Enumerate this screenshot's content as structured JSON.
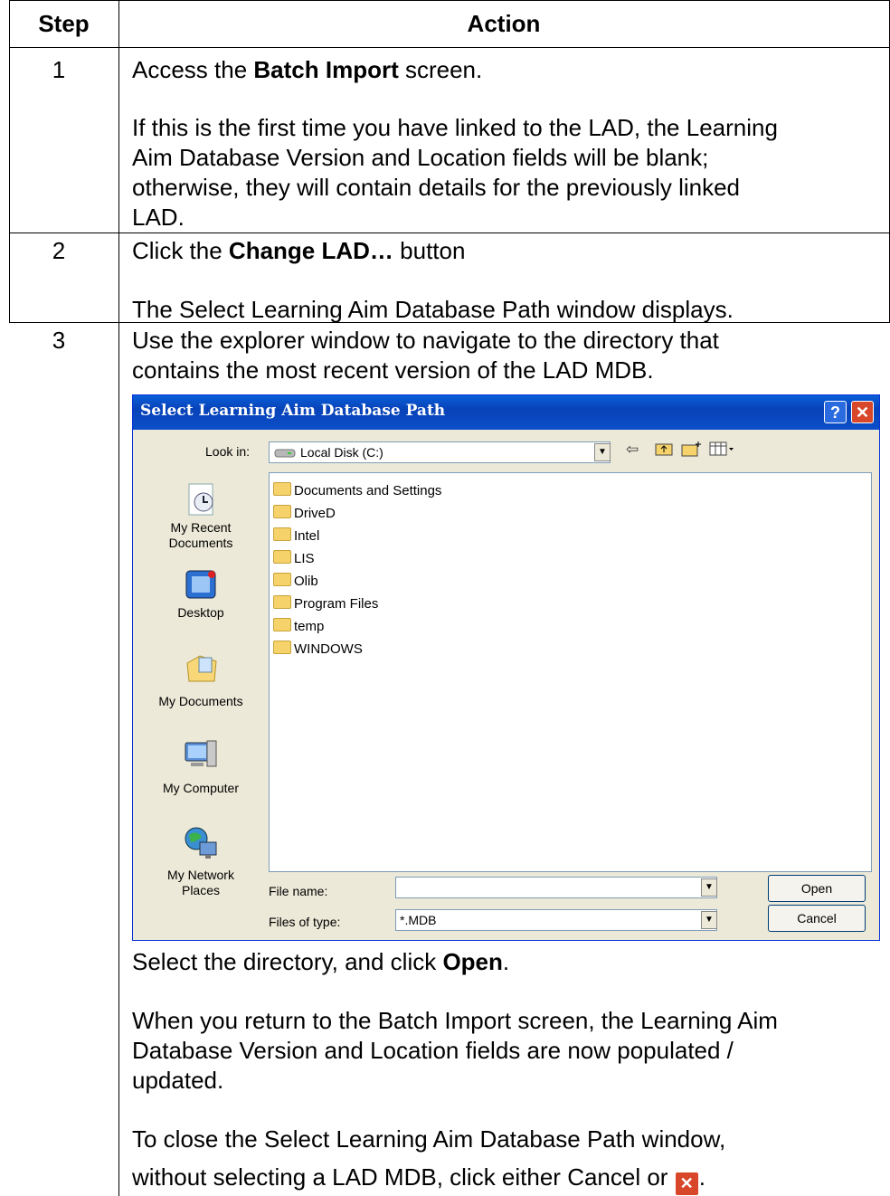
{
  "table": {
    "header_step": "Step",
    "header_action": "Action",
    "rows": [
      {
        "step": "1",
        "lines": [
          {
            "pre": "Access the ",
            "bold": "Batch Import",
            "post": " screen."
          },
          {
            "text": "If this is the first time you have linked to the LAD, the Learning"
          },
          {
            "text": "Aim Database Version and Location fields will be blank;"
          },
          {
            "text": "otherwise, they will contain details for the previously linked"
          },
          {
            "text": "LAD."
          }
        ]
      },
      {
        "step": "2",
        "lines": [
          {
            "pre": "Click the ",
            "bold": "Change LAD…",
            "post": " button"
          },
          {
            "text": "The Select Learning Aim Database Path window displays."
          }
        ]
      },
      {
        "step": "3",
        "lines": [
          {
            "text": "Use the explorer window to navigate to the directory that"
          },
          {
            "text": "contains the most recent version of the LAD MDB."
          },
          {
            "pre": "Select the directory, and click ",
            "bold": "Open",
            "post": "."
          },
          {
            "text": "When you return to the Batch Import screen, the Learning Aim"
          },
          {
            "text": "Database Version and Location fields are now populated /"
          },
          {
            "text": "updated."
          },
          {
            "text": "To close the Select Learning Aim Database Path window,"
          },
          {
            "text": "without selecting a LAD MDB, click either Cancel or",
            "post": "."
          }
        ]
      }
    ]
  },
  "dialog": {
    "title": "Select Learning Aim Database Path",
    "help_label": "?",
    "close_label": "✕",
    "look_in_label": "Look in:",
    "look_in_value": "Local Disk (C:)",
    "places": [
      "My Recent Documents",
      "Desktop",
      "My Documents",
      "My Computer",
      "My Network Places"
    ],
    "folders": [
      "Documents and Settings",
      "DriveD",
      "Intel",
      "LIS",
      "Olib",
      "Program Files",
      "temp",
      "WINDOWS"
    ],
    "file_name_label": "File name:",
    "file_name_value": "",
    "files_of_type_label": "Files of type:",
    "files_of_type_value": "*.MDB",
    "open_label": "Open",
    "cancel_label": "Cancel"
  },
  "icons": [
    "back-arrow-icon",
    "up-folder-icon",
    "new-folder-icon",
    "views-menu-icon",
    "close-icon"
  ]
}
